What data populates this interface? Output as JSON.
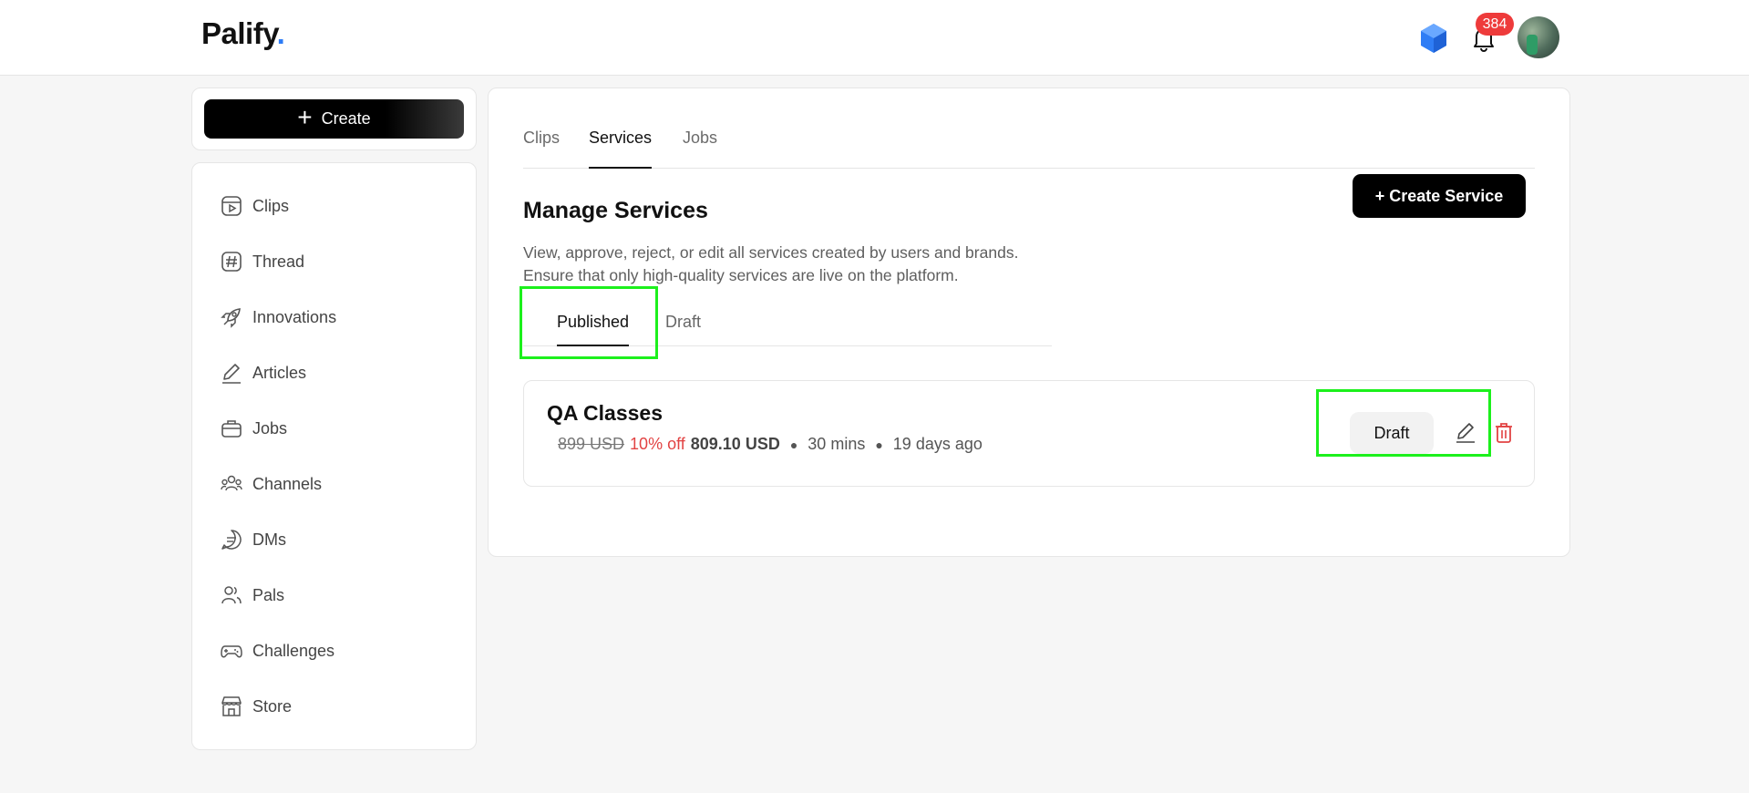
{
  "header": {
    "logo_text": "Palify",
    "logo_dot": ".",
    "notification_count": "384",
    "icons": [
      "cube-icon",
      "bell-icon",
      "avatar"
    ]
  },
  "create": {
    "label": "Create"
  },
  "sidebar": {
    "items": [
      {
        "label": "Clips",
        "icon": "clips-icon"
      },
      {
        "label": "Thread",
        "icon": "hashtag-icon"
      },
      {
        "label": "Innovations",
        "icon": "rocket-icon"
      },
      {
        "label": "Articles",
        "icon": "pen-icon"
      },
      {
        "label": "Jobs",
        "icon": "briefcase-icon"
      },
      {
        "label": "Channels",
        "icon": "people-group-icon"
      },
      {
        "label": "DMs",
        "icon": "chat-bubble-icon"
      },
      {
        "label": "Pals",
        "icon": "users-icon"
      },
      {
        "label": "Challenges",
        "icon": "gamepad-icon"
      },
      {
        "label": "Store",
        "icon": "storefront-icon"
      }
    ]
  },
  "main": {
    "tabs": [
      {
        "label": "Clips",
        "active": false
      },
      {
        "label": "Services",
        "active": true
      },
      {
        "label": "Jobs",
        "active": false
      }
    ],
    "create_service_label": "+ Create Service",
    "title": "Manage Services",
    "description_line1": "View, approve, reject, or edit all services created by users and brands.",
    "description_line2": "Ensure that only high-quality services are live on the platform.",
    "subtabs": [
      {
        "label": "Published",
        "active": true
      },
      {
        "label": "Draft",
        "active": false
      }
    ],
    "service": {
      "name": "QA Classes",
      "original_price": "899 USD",
      "discount": "10% off",
      "final_price": "809.10 USD",
      "duration": "30 mins",
      "posted": "19 days ago",
      "status_button": "Draft"
    }
  },
  "colors": {
    "accent_blue": "#2d7cf6",
    "badge_red": "#ee3b3b",
    "discount_red": "#e24343",
    "highlight_green": "#1cf01c"
  }
}
